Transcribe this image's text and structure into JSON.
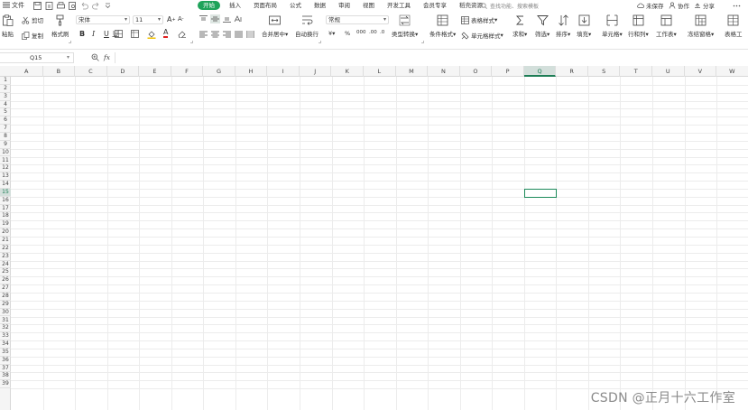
{
  "menubar": {
    "file_label": "文件",
    "tabs": [
      "开始",
      "插入",
      "页面布局",
      "公式",
      "数据",
      "审阅",
      "视图",
      "开发工具",
      "会员专享",
      "稻壳资源"
    ],
    "active_tab": "开始",
    "search_placeholder": "查找功能、搜索模板",
    "unsaved_label": "未保存",
    "collab_label": "协作",
    "share_label": "分享",
    "accent_color": "#1fa35a"
  },
  "ribbon": {
    "paste": "粘贴",
    "cut": "剪切",
    "copy": "复制",
    "format_painter": "格式刷",
    "font_name": "宋体",
    "font_size": "11",
    "bold": "B",
    "italic": "I",
    "underline": "U",
    "merge_center": "合并居中",
    "wrap_text": "自动换行",
    "number_format": "常规",
    "currency": "¥",
    "percent": "%",
    "thousands": "000",
    "dec_inc": ".00",
    "dec_dec": ".0",
    "type_convert": "类型转换",
    "conditional_format": "条件格式",
    "table_style": "表格样式",
    "cell_style": "单元格样式",
    "sum": "求和",
    "filter": "筛选",
    "sort": "排序",
    "fill": "填充",
    "cell": "单元格",
    "row_col": "行和列",
    "worksheet": "工作表",
    "freeze": "冻结窗格",
    "table_tools": "表格工"
  },
  "formula_bar": {
    "name_box": "Q15",
    "fx": "fx",
    "value": ""
  },
  "sheet": {
    "columns": [
      "A",
      "B",
      "C",
      "D",
      "E",
      "F",
      "G",
      "H",
      "I",
      "J",
      "K",
      "L",
      "M",
      "N",
      "O",
      "P",
      "Q",
      "R",
      "S",
      "T",
      "U",
      "V",
      "W"
    ],
    "rows": [
      "1",
      "2",
      "3",
      "4",
      "5",
      "6",
      "7",
      "8",
      "9",
      "10",
      "11",
      "12",
      "13",
      "14",
      "15",
      "16",
      "17",
      "18",
      "19",
      "20",
      "21",
      "22",
      "23",
      "24",
      "25",
      "26",
      "27",
      "28",
      "29",
      "30",
      "31",
      "32",
      "33",
      "34",
      "35",
      "36",
      "37",
      "38",
      "39"
    ],
    "selected_column": "Q",
    "selected_row": "15",
    "selection_color": "#1d8a5a"
  },
  "watermark": "CSDN @正月十六工作室"
}
